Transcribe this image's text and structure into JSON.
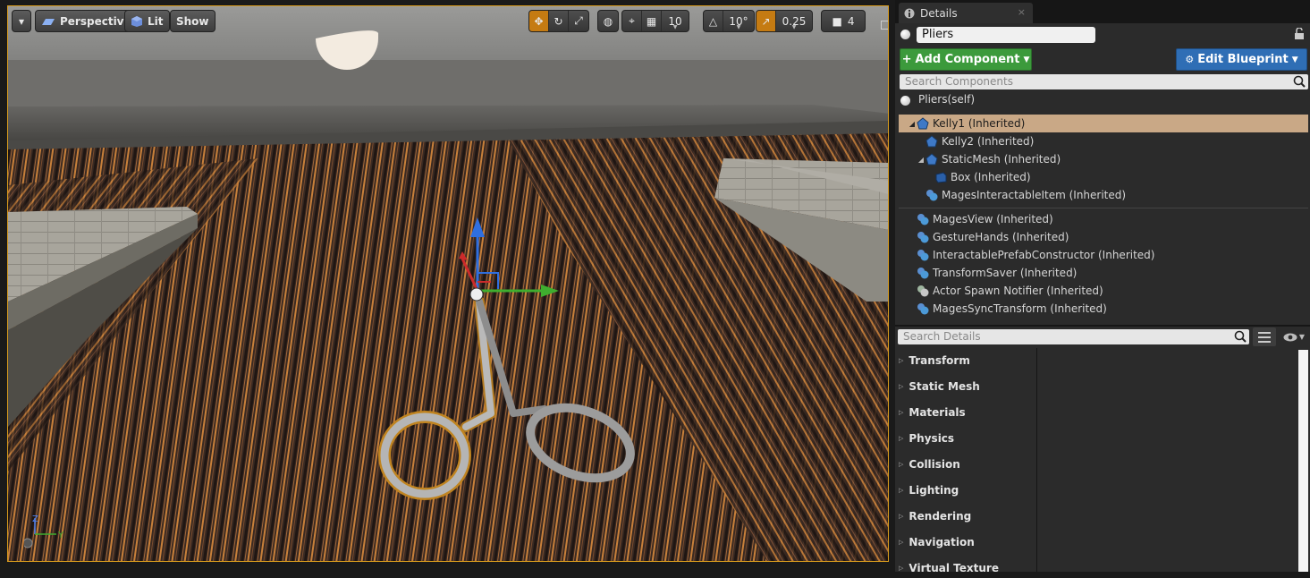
{
  "viewport": {
    "menu_icon": "chevron-down-icon",
    "perspective_label": "Perspective",
    "lit_label": "Lit",
    "show_label": "Show",
    "grid_snap": "10",
    "rotation_snap": "10°",
    "scale_snap": "0.25",
    "camera_speed": "4",
    "axis": {
      "z": "Z",
      "y": "Y"
    }
  },
  "details": {
    "tab_label": "Details",
    "tab_close": "×",
    "actor_name": "Pliers",
    "add_component_label": "Add Component",
    "edit_blueprint_label": "Edit Blueprint",
    "search_components_placeholder": "Search Components",
    "self_label": "Pliers(self)",
    "tree": [
      {
        "label": "Kelly1 (Inherited)",
        "icon": "scene-component-icon",
        "arrow": "◢",
        "selected": true
      },
      {
        "label": "Kelly2 (Inherited)",
        "icon": "scene-component-icon",
        "arrow": ""
      },
      {
        "label": "StaticMesh (Inherited)",
        "icon": "scene-component-icon",
        "arrow": "◢"
      },
      {
        "label": "Box (Inherited)",
        "icon": "box-collision-icon",
        "arrow": ""
      },
      {
        "label": "MagesInteractableItem (Inherited)",
        "icon": "actor-component-icon",
        "arrow": ""
      },
      {
        "label": "MagesView (Inherited)",
        "icon": "actor-component-icon",
        "arrow": ""
      },
      {
        "label": "GestureHands (Inherited)",
        "icon": "actor-component-icon",
        "arrow": ""
      },
      {
        "label": "InteractablePrefabConstructor (Inherited)",
        "icon": "actor-component-icon",
        "arrow": ""
      },
      {
        "label": "TransformSaver (Inherited)",
        "icon": "actor-component-icon",
        "arrow": ""
      },
      {
        "label": "Actor Spawn Notifier (Inherited)",
        "icon": "actor-component-icon",
        "arrow": ""
      },
      {
        "label": "MagesSyncTransform (Inherited)",
        "icon": "actor-component-icon",
        "arrow": ""
      }
    ],
    "search_details_placeholder": "Search Details",
    "categories": [
      "Transform",
      "Static Mesh",
      "Materials",
      "Physics",
      "Collision",
      "Lighting",
      "Rendering",
      "Navigation",
      "Virtual Texture"
    ]
  }
}
